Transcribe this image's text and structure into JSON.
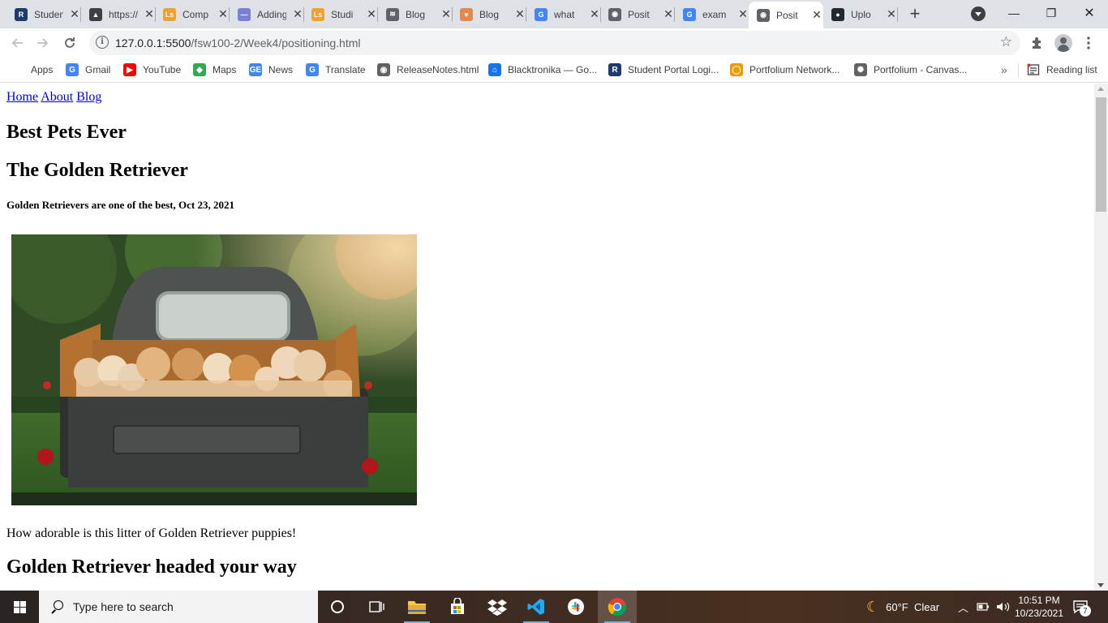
{
  "browser": {
    "tabs": [
      {
        "title": "Student Portal",
        "favicon_color": "#1f3a6e",
        "favicon_glyph": "R"
      },
      {
        "title": "https://",
        "favicon_color": "#3c4043",
        "favicon_glyph": "▲"
      },
      {
        "title": "Comp",
        "favicon_color": "#f0a030",
        "favicon_glyph": "Ls"
      },
      {
        "title": "Adding",
        "favicon_color": "#7b7fd6",
        "favicon_glyph": "—"
      },
      {
        "title": "Studi",
        "favicon_color": "#f0a030",
        "favicon_glyph": "Ls"
      },
      {
        "title": "Blog",
        "favicon_color": "#5f6368",
        "favicon_glyph": "≋"
      },
      {
        "title": "Blog",
        "favicon_color": "#e8874d",
        "favicon_glyph": "♥"
      },
      {
        "title": "what",
        "favicon_color": "#4285f4",
        "favicon_glyph": "G"
      },
      {
        "title": "Posit",
        "favicon_color": "#5f6368",
        "favicon_glyph": "◉"
      },
      {
        "title": "exam",
        "favicon_color": "#4285f4",
        "favicon_glyph": "G"
      },
      {
        "title": "Posit",
        "favicon_color": "#5f6368",
        "favicon_glyph": "◉"
      },
      {
        "title": "Uplo",
        "favicon_color": "#24292f",
        "favicon_glyph": "●"
      }
    ],
    "active_tab_index": 10,
    "new_tab_label": "+",
    "window_controls": {
      "minimize": "—",
      "restore": "❐",
      "close": "✕"
    },
    "address": {
      "host": "127.0.0.1:5500",
      "path": "/fsw100-2/Week4/positioning.html"
    },
    "bookmarks": [
      {
        "label": "Apps",
        "icon": "apps-grid-icon"
      },
      {
        "label": "Gmail",
        "icon": "google-icon",
        "color": "#4285f4",
        "glyph": "G"
      },
      {
        "label": "YouTube",
        "icon": "youtube-icon",
        "color": "#ff0000",
        "glyph": "▶"
      },
      {
        "label": "Maps",
        "icon": "maps-icon",
        "color": "#34a853",
        "glyph": "◆"
      },
      {
        "label": "News",
        "icon": "news-icon",
        "color": "#4285f4",
        "glyph": "GE"
      },
      {
        "label": "Translate",
        "icon": "translate-icon",
        "color": "#4285f4",
        "glyph": "G"
      },
      {
        "label": "ReleaseNotes.html",
        "icon": "globe-icon",
        "color": "#5f6368",
        "glyph": "◉"
      },
      {
        "label": "Blacktronika — Go...",
        "icon": "bank-icon",
        "color": "#1a73e8",
        "glyph": "⌂"
      },
      {
        "label": "Student Portal Logi...",
        "icon": "portal-icon",
        "color": "#1f3a6e",
        "glyph": "R"
      },
      {
        "label": "Portfolium Network...",
        "icon": "portfolium-icon",
        "color": "#f29900",
        "glyph": "◯"
      },
      {
        "label": "Portfolium - Canvas...",
        "icon": "canvas-icon",
        "color": "#5f6368",
        "glyph": "✺"
      }
    ],
    "reading_list": "Reading list",
    "more_bookmarks": "»"
  },
  "page": {
    "nav": [
      "Home",
      "About",
      "Blog"
    ],
    "heading": "Best Pets Ever",
    "subheading": "The Golden Retriever",
    "byline": "Golden Retrievers are one of the best, Oct 23, 2021",
    "image_alt": "Golden Retriever puppies in a truck bed",
    "caption": "How adorable is this litter of Golden Retriever puppies!",
    "section_heading": "Golden Retriever headed your way"
  },
  "taskbar": {
    "search_placeholder": "Type here to search",
    "weather": "60°F  Clear",
    "time": "10:51 PM",
    "date": "10/23/2021",
    "notification_count": "7"
  }
}
